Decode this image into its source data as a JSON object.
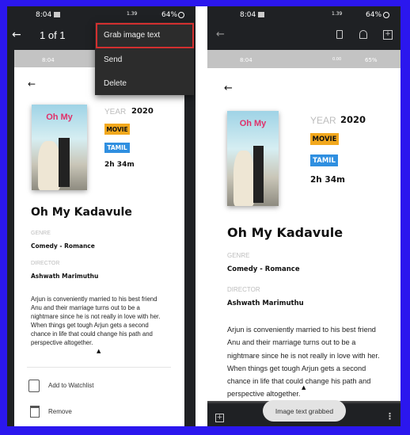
{
  "left": {
    "status": {
      "time": "8:04",
      "battery": "64%",
      "net": "1.39"
    },
    "toolbar": {
      "title": "1 of 1"
    },
    "inner_status": {
      "time": "8:04"
    },
    "menu": [
      {
        "label": "Grab image text",
        "highlighted": true
      },
      {
        "label": "Send"
      },
      {
        "label": "Delete"
      }
    ],
    "actions": [
      {
        "label": "Add to Watchlist",
        "icon": "watchlist-icon"
      },
      {
        "label": "Remove",
        "icon": "trash-icon"
      }
    ]
  },
  "right": {
    "status": {
      "time": "8:04",
      "battery": "64%",
      "net": "1.39"
    },
    "inner_status": {
      "time": "8:04",
      "battery": "65%",
      "net": "0.00"
    },
    "toast": "Image text grabbed"
  },
  "movie": {
    "poster_text": "Oh My",
    "year_label": "YEAR",
    "year": "2020",
    "type_badge": "MOVIE",
    "language_badge": "TAMIL",
    "duration": "2h 34m",
    "title": "Oh My Kadavule",
    "genre_label": "GENRE",
    "genre": "Comedy - Romance",
    "director_label": "DIRECTOR",
    "director": "Ashwath Marimuthu",
    "description_lines": [
      "Arjun is conveniently married to his best friend",
      "Anu and their marriage turns out to be a",
      "nightmare since he is not really in love with her.",
      "When things get tough Arjun gets a second",
      "chance in life that could change his path and",
      "perspective altogether."
    ]
  },
  "colors": {
    "background": "#2b17ee",
    "highlight": "#d32f2f",
    "movie_badge": "#f2a81d",
    "tamil_badge": "#2f8fe0"
  }
}
